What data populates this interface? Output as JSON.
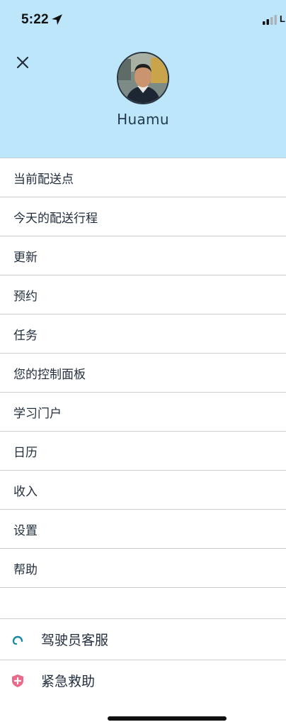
{
  "status_bar": {
    "time": "5:22",
    "carrier": "L",
    "location_icon": "location-arrow-icon",
    "signal_icon": "cellular-signal-icon"
  },
  "header": {
    "close_icon": "close-icon",
    "username": "Huamu",
    "background_color": "#bde6fb"
  },
  "menu": {
    "items": [
      "当前配送点",
      "今天的配送行程",
      "更新",
      "预约",
      "任务",
      "您的控制面板",
      "学习门户",
      "日历",
      "收入",
      "设置",
      "帮助"
    ]
  },
  "footer": {
    "support": {
      "label": "驾驶员客服",
      "icon": "headset-icon",
      "color": "#1a8aa3"
    },
    "emergency": {
      "label": "紧急救助",
      "icon": "shield-plus-icon",
      "color": "#e86b8a"
    }
  }
}
